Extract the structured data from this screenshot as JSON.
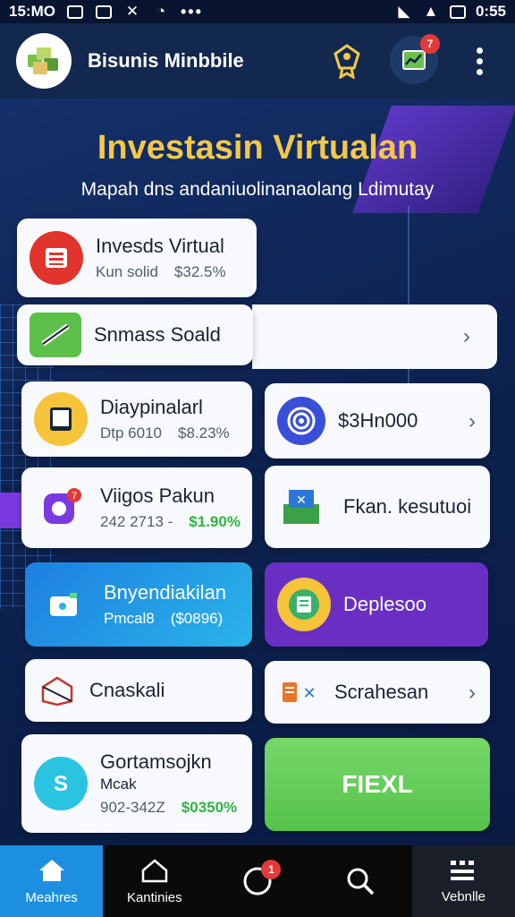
{
  "status_bar": {
    "time_left": "15:MO",
    "time_right": "0:55"
  },
  "header": {
    "app_name": "Bisunis Minbbile",
    "cart_badge": "7"
  },
  "hero": {
    "title": "Investasin Virtualan",
    "subtitle": "Mapah dns andaniuolinanaolang Ldimutay"
  },
  "cards": {
    "invest_virtual": {
      "title": "Invesds Virtual",
      "meta1": "Kun solid",
      "meta2": "$32.5%"
    },
    "smmass": {
      "title": "Snmass Soald"
    },
    "diagram": {
      "title": "Diaypinalarl",
      "meta1": "Dtp 6010",
      "meta2": "$8.23%"
    },
    "price": {
      "title": "$3Hn000"
    },
    "vigos": {
      "title": "Viigos Pakun",
      "meta1": "242 2713 -",
      "meta2": "$1.90%"
    },
    "fkan": {
      "title": "Fkan. kesutuoi"
    },
    "bnvend": {
      "title": "Bnyendiakilan",
      "meta1": "Pmcal8",
      "meta2": "($0896)"
    },
    "deplesoo": {
      "title": "Deplesoo"
    },
    "cnaskali": {
      "title": "Cnaskali"
    },
    "scrahesan": {
      "title": "Scrahesan"
    },
    "gontam": {
      "title": "Gortamsojkn",
      "subtitle": "Mcak",
      "meta1": "902-342Z",
      "meta2": "$0350%"
    },
    "fiexl": {
      "title": "FIEXL"
    }
  },
  "bottom_nav": {
    "items": [
      {
        "label": "Meahres"
      },
      {
        "label": "Kantinies"
      },
      {
        "label": "",
        "badge": "1"
      },
      {
        "label": ""
      },
      {
        "label": "Vebnlle"
      }
    ]
  },
  "colors": {
    "accent_blue": "#1d8fe0",
    "title_gold": "#f3c84a",
    "purple": "#6a2fc2",
    "green": "#55c24a",
    "badge_red": "#e23a3a"
  }
}
